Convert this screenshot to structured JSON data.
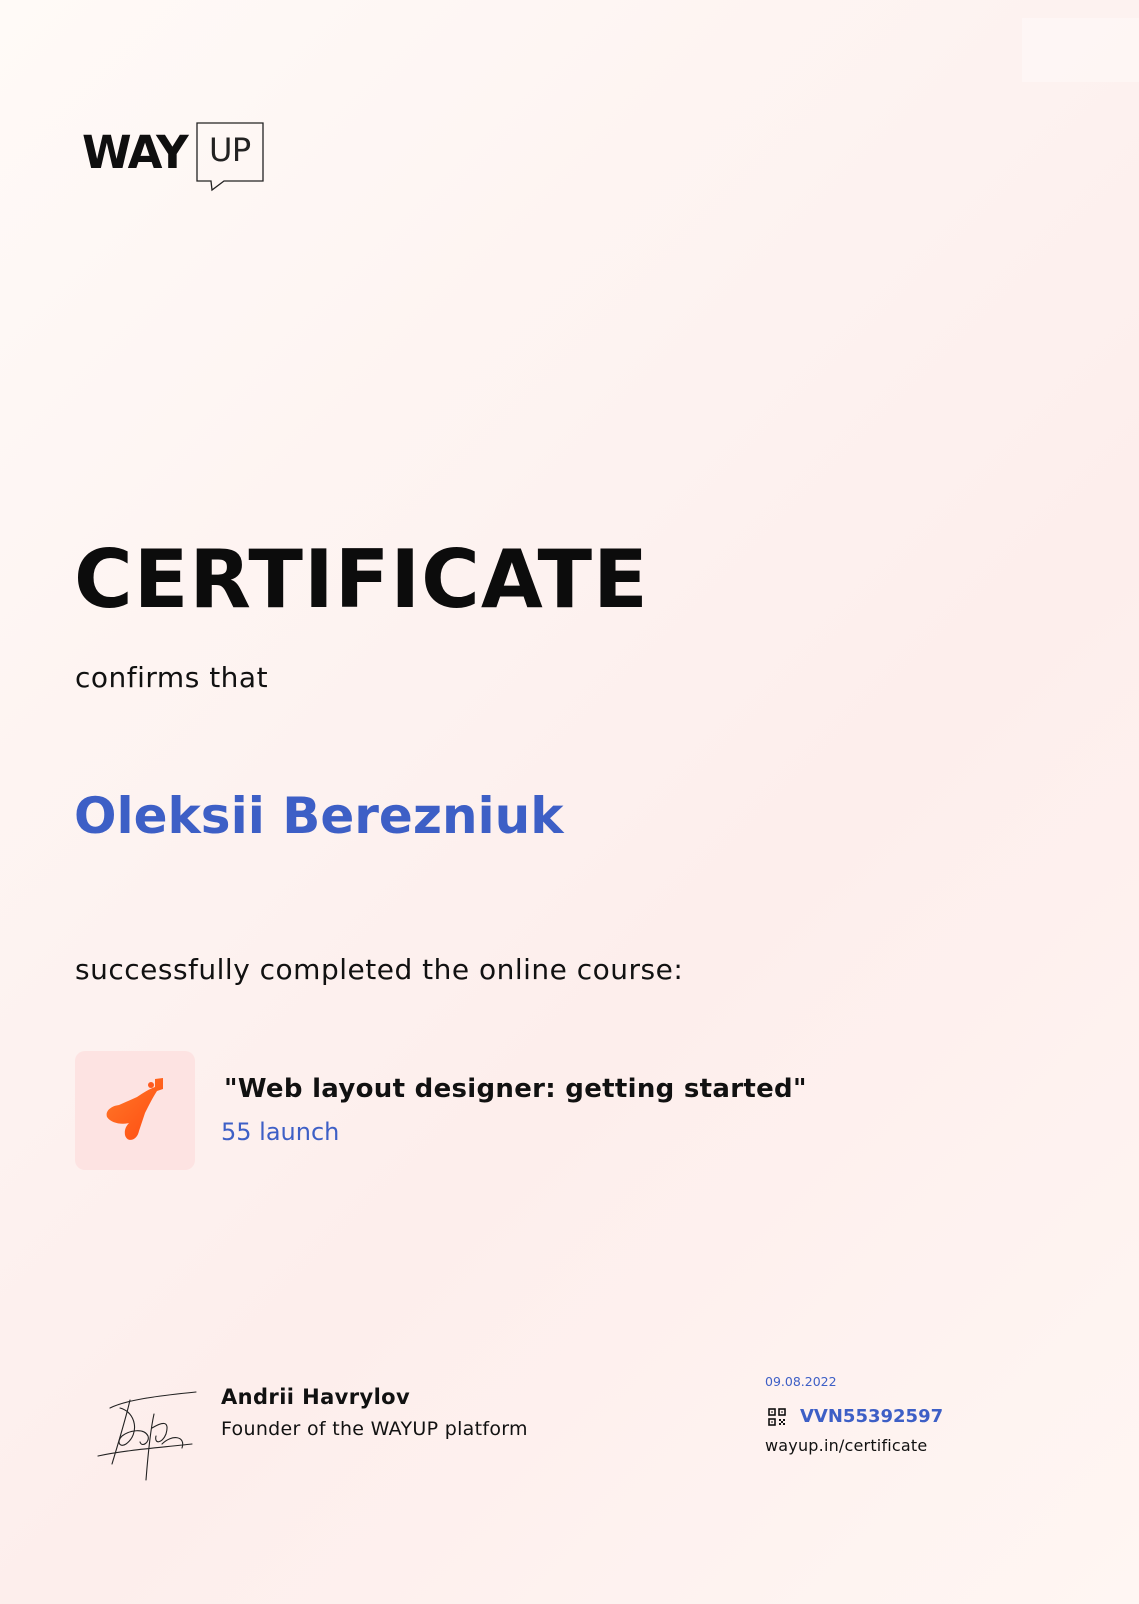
{
  "logo": {
    "way": "WAY",
    "up": "UP"
  },
  "certificate": {
    "title": "CERTIFICATE",
    "confirms": "confirms that",
    "recipient": "Oleksii Berezniuk",
    "completed": "successfully completed the online course:"
  },
  "course": {
    "title": "\"Web layout designer: getting started\"",
    "launch": "55 launch",
    "icon": "blaster-gun-icon"
  },
  "signer": {
    "name": "Andrii Havrylov",
    "role": "Founder of the WAYUP platform"
  },
  "verification": {
    "date": "09.08.2022",
    "code": "VVN55392597",
    "url": "wayup.in/certificate",
    "icon": "qr-code-icon"
  },
  "colors": {
    "accent": "#3d5fc6",
    "text": "#111111",
    "icon_bg": "#fde3e2",
    "icon_fg": "#ff5a1f"
  }
}
